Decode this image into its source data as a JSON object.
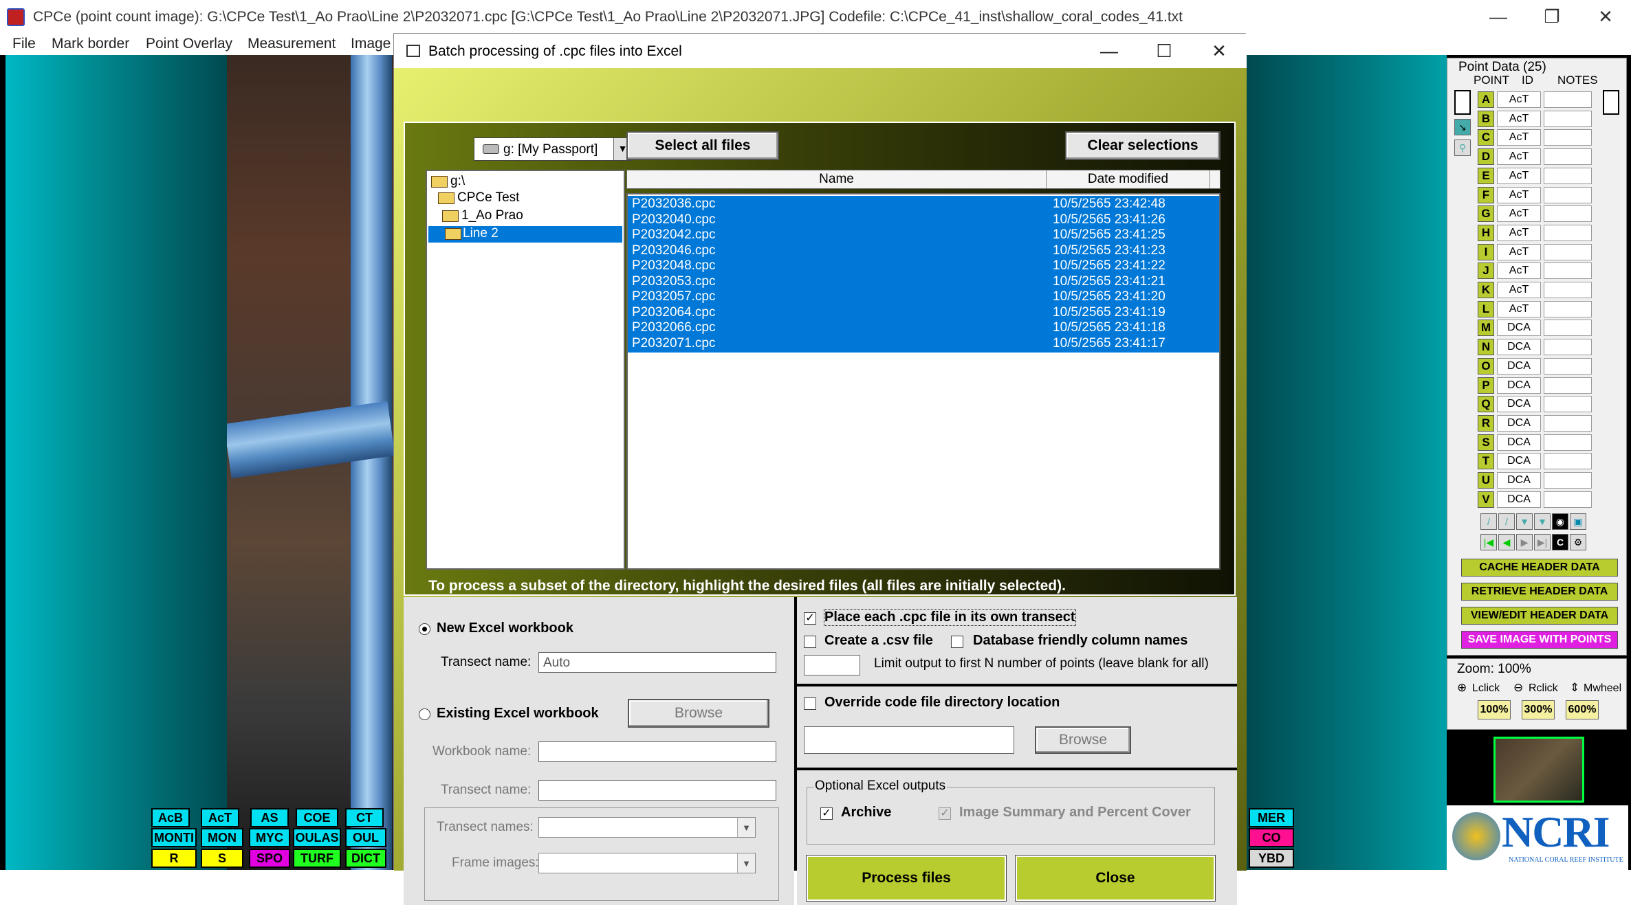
{
  "window": {
    "title": "CPCe (point count image): G:\\CPCe Test\\1_Ao Prao\\Line 2\\P2032071.cpc [G:\\CPCe Test\\1_Ao Prao\\Line 2\\P2032071.JPG]       Codefile: C:\\CPCe_41_inst\\shallow_coral_codes_41.txt",
    "minimize": "—",
    "restore": "❐",
    "close": "✕"
  },
  "menu": [
    "File",
    "Mark border",
    "Point Overlay",
    "Measurement",
    "Image"
  ],
  "codes": {
    "row1": [
      "AcB",
      "AcT",
      "AS",
      "COE",
      "CT"
    ],
    "row2": [
      "MONTI",
      "MON",
      "MYC",
      "OULAS",
      "OUL"
    ],
    "row3": [
      "R",
      "S",
      "SPO",
      "TURF",
      "DICT"
    ],
    "right": [
      "MER",
      "CO",
      "YBD"
    ]
  },
  "colors": {
    "accent_green": "#b8cc30",
    "selection_blue": "#0078d7",
    "code_cyan": "#00e0f0",
    "code_yellow": "#ffff00",
    "code_magenta": "#e000e0",
    "code_green": "#20ff20"
  },
  "dialog": {
    "title": "Batch processing of .cpc files into Excel",
    "minimize": "—",
    "maximize": "☐",
    "close": "✕",
    "drive": "g: [My Passport]",
    "select_all": "Select all files",
    "clear_selections": "Clear selections",
    "tree": [
      "g:\\",
      "CPCe Test",
      "1_Ao Prao",
      "Line 2"
    ],
    "columns": {
      "name": "Name",
      "date": "Date modified"
    },
    "files": [
      {
        "name": "P2032036.cpc",
        "date": "10/5/2565 23:42:48"
      },
      {
        "name": "P2032040.cpc",
        "date": "10/5/2565 23:41:26"
      },
      {
        "name": "P2032042.cpc",
        "date": "10/5/2565 23:41:25"
      },
      {
        "name": "P2032046.cpc",
        "date": "10/5/2565 23:41:23"
      },
      {
        "name": "P2032048.cpc",
        "date": "10/5/2565 23:41:22"
      },
      {
        "name": "P2032053.cpc",
        "date": "10/5/2565 23:41:21"
      },
      {
        "name": "P2032057.cpc",
        "date": "10/5/2565 23:41:20"
      },
      {
        "name": "P2032064.cpc",
        "date": "10/5/2565 23:41:19"
      },
      {
        "name": "P2032066.cpc",
        "date": "10/5/2565 23:41:18"
      },
      {
        "name": "P2032071.cpc",
        "date": "10/5/2565 23:41:17"
      }
    ],
    "hint": "To process a subset of the directory, highlight the desired files (all files are initially selected).",
    "new_workbook": "New Excel workbook",
    "transect_name_label": "Transect name:",
    "transect_name_value": "Auto",
    "existing_workbook": "Existing Excel workbook",
    "browse": "Browse",
    "workbook_name_label": "Workbook name:",
    "transect_name_label2": "Transect name:",
    "transect_names_label": "Transect names:",
    "frame_images_label": "Frame images:",
    "place_each": "Place each .cpc file in its own transect",
    "create_csv": "Create a .csv file",
    "db_friendly": "Database friendly column names",
    "limit_output": "Limit output to first N number of points (leave blank for all)",
    "override_code": "Override code file directory location",
    "browse2": "Browse",
    "optional_outputs": "Optional Excel outputs",
    "archive": "Archive",
    "image_summary": "Image Summary and Percent Cover",
    "process_files": "Process files",
    "close_btn": "Close"
  },
  "point_panel": {
    "title": "Point Data (25)",
    "col_point": "POINT",
    "col_id": "ID",
    "col_notes": "NOTES",
    "points": [
      {
        "p": "A",
        "id": "AcT"
      },
      {
        "p": "B",
        "id": "AcT"
      },
      {
        "p": "C",
        "id": "AcT"
      },
      {
        "p": "D",
        "id": "AcT"
      },
      {
        "p": "E",
        "id": "AcT"
      },
      {
        "p": "F",
        "id": "AcT"
      },
      {
        "p": "G",
        "id": "AcT"
      },
      {
        "p": "H",
        "id": "AcT"
      },
      {
        "p": "I",
        "id": "AcT"
      },
      {
        "p": "J",
        "id": "AcT"
      },
      {
        "p": "K",
        "id": "AcT"
      },
      {
        "p": "L",
        "id": "AcT"
      },
      {
        "p": "M",
        "id": "DCA"
      },
      {
        "p": "N",
        "id": "DCA"
      },
      {
        "p": "O",
        "id": "DCA"
      },
      {
        "p": "P",
        "id": "DCA"
      },
      {
        "p": "Q",
        "id": "DCA"
      },
      {
        "p": "R",
        "id": "DCA"
      },
      {
        "p": "S",
        "id": "DCA"
      },
      {
        "p": "T",
        "id": "DCA"
      },
      {
        "p": "U",
        "id": "DCA"
      },
      {
        "p": "V",
        "id": "DCA"
      }
    ],
    "cache_header": "CACHE HEADER DATA",
    "retrieve_header": "RETRIEVE HEADER DATA",
    "view_header": "VIEW/EDIT HEADER DATA",
    "save_image": "SAVE IMAGE WITH POINTS",
    "c_label": "C"
  },
  "zoom": {
    "label": "Zoom:  100%",
    "lclick": "Lclick",
    "rclick": "Rclick",
    "mwheel": "Mwheel",
    "z100": "100%",
    "z300": "300%",
    "z600": "600%"
  },
  "logo": {
    "text": "NCRI",
    "subtitle": "NATIONAL CORAL REEF INSTITUTE"
  }
}
